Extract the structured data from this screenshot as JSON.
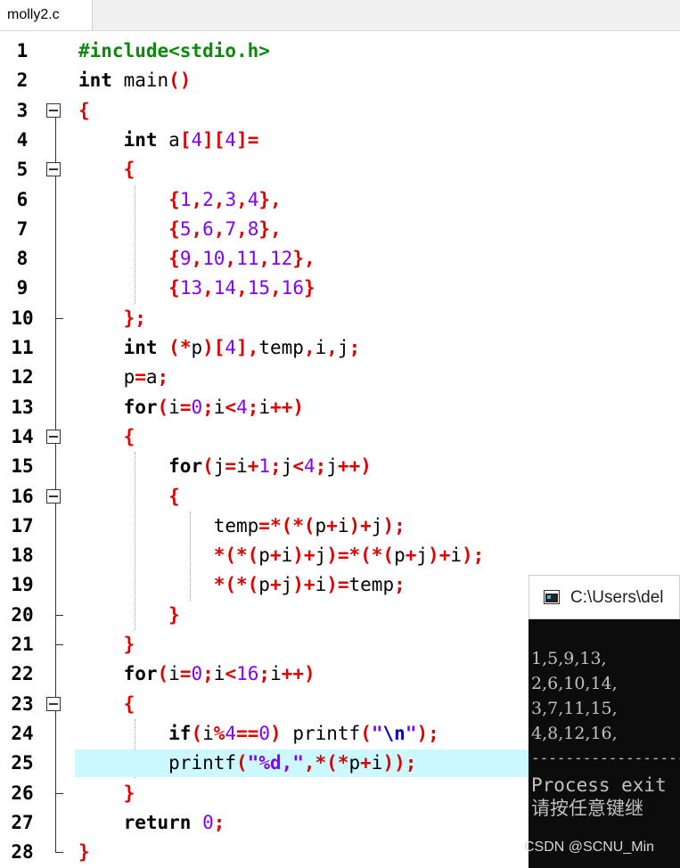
{
  "tab": {
    "label": "molly2.c"
  },
  "lines": [
    {
      "n": "1",
      "fold": "none",
      "hl": false,
      "toks": [
        [
          "pp",
          "#include<stdio.h>"
        ]
      ]
    },
    {
      "n": "2",
      "fold": "none",
      "hl": false,
      "toks": [
        [
          "kw",
          "int"
        ],
        [
          "id",
          " main"
        ],
        [
          "op",
          "()"
        ]
      ]
    },
    {
      "n": "3",
      "fold": "box",
      "hl": false,
      "toks": [
        [
          "op",
          "{"
        ]
      ]
    },
    {
      "n": "4",
      "fold": "none",
      "hl": false,
      "toks": [
        [
          "sp",
          "    "
        ],
        [
          "kw",
          "int"
        ],
        [
          "id",
          " a"
        ],
        [
          "op",
          "["
        ],
        [
          "num",
          "4"
        ],
        [
          "op",
          "]["
        ],
        [
          "num",
          "4"
        ],
        [
          "op",
          "]="
        ]
      ]
    },
    {
      "n": "5",
      "fold": "box",
      "hl": false,
      "toks": [
        [
          "sp",
          "    "
        ],
        [
          "op",
          "{"
        ]
      ]
    },
    {
      "n": "6",
      "fold": "none",
      "hl": false,
      "toks": [
        [
          "sp",
          "        "
        ],
        [
          "op",
          "{"
        ],
        [
          "num",
          "1"
        ],
        [
          "op",
          ","
        ],
        [
          "num",
          "2"
        ],
        [
          "op",
          ","
        ],
        [
          "num",
          "3"
        ],
        [
          "op",
          ","
        ],
        [
          "num",
          "4"
        ],
        [
          "op",
          "},"
        ]
      ]
    },
    {
      "n": "7",
      "fold": "none",
      "hl": false,
      "toks": [
        [
          "sp",
          "        "
        ],
        [
          "op",
          "{"
        ],
        [
          "num",
          "5"
        ],
        [
          "op",
          ","
        ],
        [
          "num",
          "6"
        ],
        [
          "op",
          ","
        ],
        [
          "num",
          "7"
        ],
        [
          "op",
          ","
        ],
        [
          "num",
          "8"
        ],
        [
          "op",
          "},"
        ]
      ]
    },
    {
      "n": "8",
      "fold": "none",
      "hl": false,
      "toks": [
        [
          "sp",
          "        "
        ],
        [
          "op",
          "{"
        ],
        [
          "num",
          "9"
        ],
        [
          "op",
          ","
        ],
        [
          "num",
          "10"
        ],
        [
          "op",
          ","
        ],
        [
          "num",
          "11"
        ],
        [
          "op",
          ","
        ],
        [
          "num",
          "12"
        ],
        [
          "op",
          "},"
        ]
      ]
    },
    {
      "n": "9",
      "fold": "none",
      "hl": false,
      "toks": [
        [
          "sp",
          "        "
        ],
        [
          "op",
          "{"
        ],
        [
          "num",
          "13"
        ],
        [
          "op",
          ","
        ],
        [
          "num",
          "14"
        ],
        [
          "op",
          ","
        ],
        [
          "num",
          "15"
        ],
        [
          "op",
          ","
        ],
        [
          "num",
          "16"
        ],
        [
          "op",
          "}"
        ]
      ]
    },
    {
      "n": "10",
      "fold": "tick",
      "hl": false,
      "toks": [
        [
          "sp",
          "    "
        ],
        [
          "op",
          "};"
        ]
      ]
    },
    {
      "n": "11",
      "fold": "none",
      "hl": false,
      "toks": [
        [
          "sp",
          "    "
        ],
        [
          "kw",
          "int"
        ],
        [
          "id",
          " "
        ],
        [
          "op",
          "(*"
        ],
        [
          "id",
          "p"
        ],
        [
          "op",
          ")["
        ],
        [
          "num",
          "4"
        ],
        [
          "op",
          "],"
        ],
        [
          "id",
          "temp"
        ],
        [
          "op",
          ","
        ],
        [
          "id",
          "i"
        ],
        [
          "op",
          ","
        ],
        [
          "id",
          "j"
        ],
        [
          "op",
          ";"
        ]
      ]
    },
    {
      "n": "12",
      "fold": "none",
      "hl": false,
      "toks": [
        [
          "sp",
          "    "
        ],
        [
          "id",
          "p"
        ],
        [
          "op",
          "="
        ],
        [
          "id",
          "a"
        ],
        [
          "op",
          ";"
        ]
      ]
    },
    {
      "n": "13",
      "fold": "none",
      "hl": false,
      "toks": [
        [
          "sp",
          "    "
        ],
        [
          "kw",
          "for"
        ],
        [
          "op",
          "("
        ],
        [
          "id",
          "i"
        ],
        [
          "op",
          "="
        ],
        [
          "num",
          "0"
        ],
        [
          "op",
          ";"
        ],
        [
          "id",
          "i"
        ],
        [
          "op",
          "<"
        ],
        [
          "num",
          "4"
        ],
        [
          "op",
          ";"
        ],
        [
          "id",
          "i"
        ],
        [
          "op",
          "++)"
        ]
      ]
    },
    {
      "n": "14",
      "fold": "box",
      "hl": false,
      "toks": [
        [
          "sp",
          "    "
        ],
        [
          "op",
          "{"
        ]
      ]
    },
    {
      "n": "15",
      "fold": "none",
      "hl": false,
      "toks": [
        [
          "sp",
          "        "
        ],
        [
          "kw",
          "for"
        ],
        [
          "op",
          "("
        ],
        [
          "id",
          "j"
        ],
        [
          "op",
          "="
        ],
        [
          "id",
          "i"
        ],
        [
          "op",
          "+"
        ],
        [
          "num",
          "1"
        ],
        [
          "op",
          ";"
        ],
        [
          "id",
          "j"
        ],
        [
          "op",
          "<"
        ],
        [
          "num",
          "4"
        ],
        [
          "op",
          ";"
        ],
        [
          "id",
          "j"
        ],
        [
          "op",
          "++)"
        ]
      ]
    },
    {
      "n": "16",
      "fold": "box",
      "hl": false,
      "toks": [
        [
          "sp",
          "        "
        ],
        [
          "op",
          "{"
        ]
      ]
    },
    {
      "n": "17",
      "fold": "none",
      "hl": false,
      "toks": [
        [
          "sp",
          "            "
        ],
        [
          "id",
          "temp"
        ],
        [
          "op",
          "=*(*("
        ],
        [
          "id",
          "p"
        ],
        [
          "op",
          "+"
        ],
        [
          "id",
          "i"
        ],
        [
          "op",
          ")+"
        ],
        [
          "id",
          "j"
        ],
        [
          "op",
          ");"
        ]
      ]
    },
    {
      "n": "18",
      "fold": "none",
      "hl": false,
      "toks": [
        [
          "sp",
          "            "
        ],
        [
          "op",
          "*(*("
        ],
        [
          "id",
          "p"
        ],
        [
          "op",
          "+"
        ],
        [
          "id",
          "i"
        ],
        [
          "op",
          ")+"
        ],
        [
          "id",
          "j"
        ],
        [
          "op",
          ")=*(*("
        ],
        [
          "id",
          "p"
        ],
        [
          "op",
          "+"
        ],
        [
          "id",
          "j"
        ],
        [
          "op",
          ")+"
        ],
        [
          "id",
          "i"
        ],
        [
          "op",
          ");"
        ]
      ]
    },
    {
      "n": "19",
      "fold": "none",
      "hl": false,
      "toks": [
        [
          "sp",
          "            "
        ],
        [
          "op",
          "*(*("
        ],
        [
          "id",
          "p"
        ],
        [
          "op",
          "+"
        ],
        [
          "id",
          "j"
        ],
        [
          "op",
          ")+"
        ],
        [
          "id",
          "i"
        ],
        [
          "op",
          ")="
        ],
        [
          "id",
          "temp"
        ],
        [
          "op",
          ";"
        ]
      ]
    },
    {
      "n": "20",
      "fold": "tick",
      "hl": false,
      "toks": [
        [
          "sp",
          "        "
        ],
        [
          "op",
          "}"
        ]
      ]
    },
    {
      "n": "21",
      "fold": "tick",
      "hl": false,
      "toks": [
        [
          "sp",
          "    "
        ],
        [
          "op",
          "}"
        ]
      ]
    },
    {
      "n": "22",
      "fold": "none",
      "hl": false,
      "toks": [
        [
          "sp",
          "    "
        ],
        [
          "kw",
          "for"
        ],
        [
          "op",
          "("
        ],
        [
          "id",
          "i"
        ],
        [
          "op",
          "="
        ],
        [
          "num",
          "0"
        ],
        [
          "op",
          ";"
        ],
        [
          "id",
          "i"
        ],
        [
          "op",
          "<"
        ],
        [
          "num",
          "16"
        ],
        [
          "op",
          ";"
        ],
        [
          "id",
          "i"
        ],
        [
          "op",
          "++)"
        ]
      ]
    },
    {
      "n": "23",
      "fold": "box",
      "hl": false,
      "toks": [
        [
          "sp",
          "    "
        ],
        [
          "op",
          "{"
        ]
      ]
    },
    {
      "n": "24",
      "fold": "none",
      "hl": false,
      "toks": [
        [
          "sp",
          "        "
        ],
        [
          "kw",
          "if"
        ],
        [
          "op",
          "("
        ],
        [
          "id",
          "i"
        ],
        [
          "op",
          "%"
        ],
        [
          "num",
          "4"
        ],
        [
          "op",
          "=="
        ],
        [
          "num",
          "0"
        ],
        [
          "op",
          ")"
        ],
        [
          "id",
          " printf"
        ],
        [
          "op",
          "("
        ],
        [
          "str",
          "\""
        ],
        [
          "esc",
          "\\n"
        ],
        [
          "str",
          "\""
        ],
        [
          "op",
          ");"
        ]
      ]
    },
    {
      "n": "25",
      "fold": "none",
      "hl": true,
      "toks": [
        [
          "sp",
          "        "
        ],
        [
          "id",
          "printf"
        ],
        [
          "op",
          "("
        ],
        [
          "str",
          "\"%d,\""
        ],
        [
          "op",
          ",*(*"
        ],
        [
          "id",
          "p"
        ],
        [
          "op",
          "+"
        ],
        [
          "id",
          "i"
        ],
        [
          "op",
          "));"
        ]
      ]
    },
    {
      "n": "26",
      "fold": "tick",
      "hl": false,
      "toks": [
        [
          "sp",
          "    "
        ],
        [
          "op",
          "}"
        ]
      ]
    },
    {
      "n": "27",
      "fold": "none",
      "hl": false,
      "toks": [
        [
          "sp",
          "    "
        ],
        [
          "kw",
          "return"
        ],
        [
          "id",
          " "
        ],
        [
          "num",
          "0"
        ],
        [
          "op",
          ";"
        ]
      ]
    },
    {
      "n": "28",
      "fold": "end",
      "hl": false,
      "toks": [
        [
          "op",
          "}"
        ]
      ]
    }
  ],
  "console": {
    "title": "C:\\Users\\del",
    "output": [
      "1,5,9,13,",
      "2,6,10,14,",
      "3,7,11,15,",
      "4,8,12,16,"
    ],
    "separator": "--------------------------------",
    "exit_text": "Process exit",
    "press_key": "请按任意键继"
  },
  "watermark": "CSDN @SCNU_Min"
}
